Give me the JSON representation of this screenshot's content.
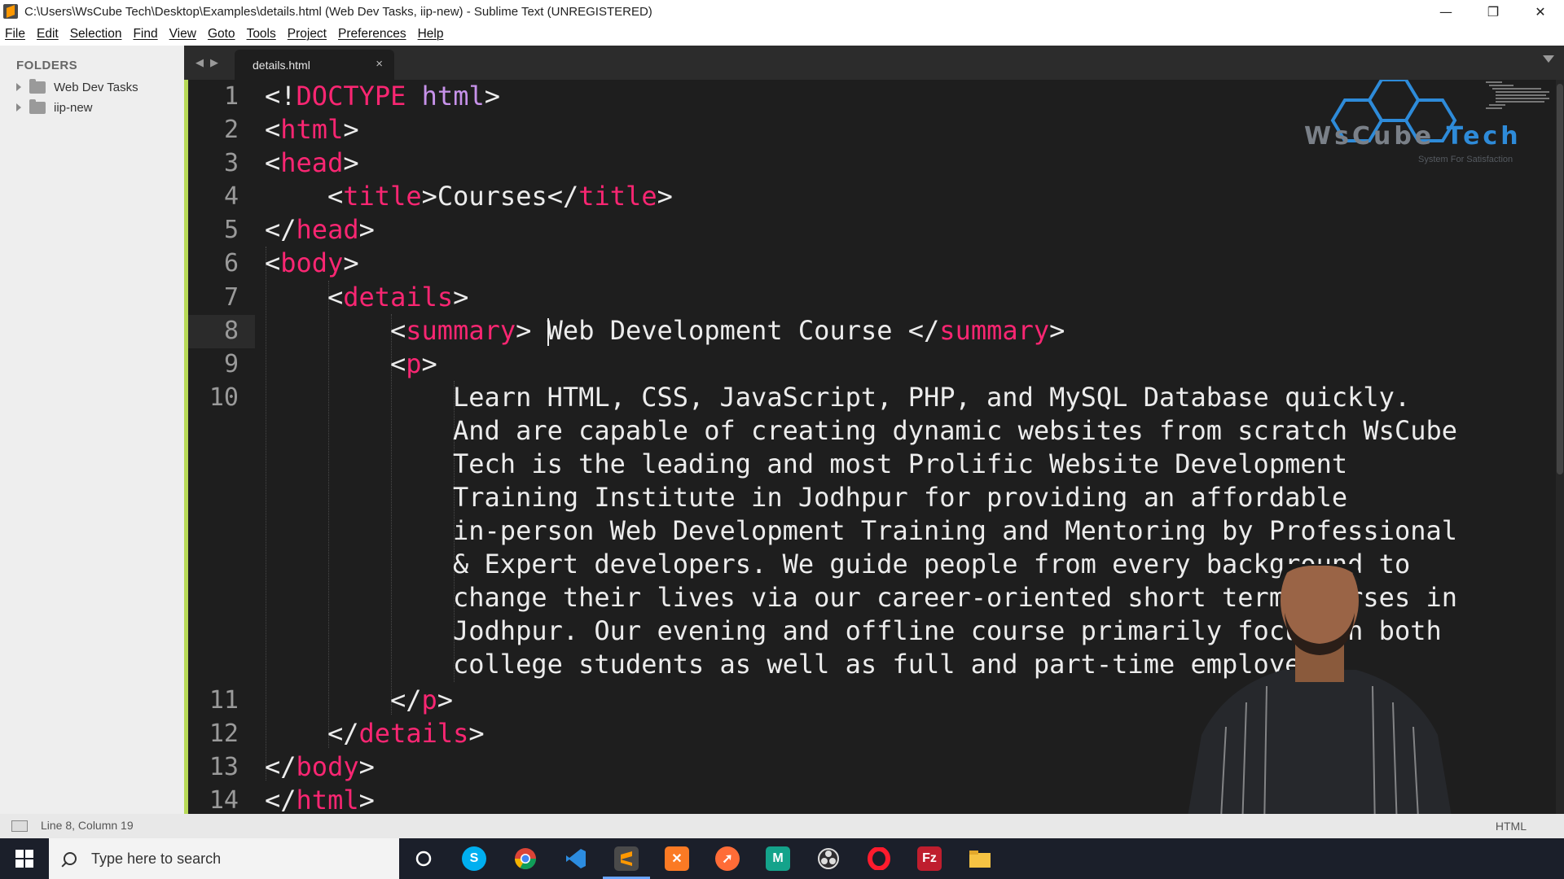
{
  "window": {
    "title": "C:\\Users\\WsCube Tech\\Desktop\\Examples\\details.html (Web Dev Tasks, iip-new) - Sublime Text (UNREGISTERED)",
    "minimize": "—",
    "restore": "❐",
    "close": "✕"
  },
  "menu": [
    "File",
    "Edit",
    "Selection",
    "Find",
    "View",
    "Goto",
    "Tools",
    "Project",
    "Preferences",
    "Help"
  ],
  "sidebar": {
    "heading": "FOLDERS",
    "folders": [
      "Web Dev Tasks",
      "iip-new"
    ]
  },
  "tabs": {
    "active": "details.html",
    "close_glyph": "×",
    "nav_back": "◀",
    "nav_forward": "▶"
  },
  "editor": {
    "line_numbers": [
      "1",
      "2",
      "3",
      "4",
      "5",
      "6",
      "7",
      "8",
      "9",
      "10",
      "",
      "",
      "",
      "",
      "",
      "",
      "",
      "",
      "11",
      "12",
      "13",
      "14"
    ],
    "current_line": "8",
    "code": {
      "l1_a": "<!",
      "l1_b": "DOCTYPE",
      "l1_c": " ",
      "l1_d": "html",
      "l1_e": ">",
      "l2_a": "<",
      "l2_b": "html",
      "l2_c": ">",
      "l3_a": "<",
      "l3_b": "head",
      "l3_c": ">",
      "l4_a": "<",
      "l4_b": "title",
      "l4_c": ">Courses</",
      "l4_d": "title",
      "l4_e": ">",
      "l5_a": "</",
      "l5_b": "head",
      "l5_c": ">",
      "l6_a": "<",
      "l6_b": "body",
      "l6_c": ">",
      "l7_a": "<",
      "l7_b": "details",
      "l7_c": ">",
      "l8_a": "<",
      "l8_b": "summary",
      "l8_c": "> ",
      "l8_d": "Web Development Course </",
      "l8_e": "summary",
      "l8_f": ">",
      "l9_a": "<",
      "l9_b": "p",
      "l9_c": ">",
      "l10_text": [
        "Learn HTML, CSS, JavaScript, PHP, and MySQL Database quickly.",
        "And are capable of creating dynamic websites from scratch WsCube",
        "Tech is the leading and most Prolific Website Development",
        "Training Institute in Jodhpur for providing an affordable",
        "in-person Web Development Training and Mentoring by Professional",
        "& Expert developers. We guide people from every background to",
        "change their lives via our career-oriented short term courses in",
        "Jodhpur. Our evening and offline course primarily focus on both",
        "college students as well as full and part-time employees."
      ],
      "l11_a": "</",
      "l11_b": "p",
      "l11_c": ">",
      "l12_a": "</",
      "l12_b": "details",
      "l12_c": ">",
      "l13_a": "</",
      "l13_b": "body",
      "l13_c": ">",
      "l14_a": "</",
      "l14_b": "html",
      "l14_c": ">"
    }
  },
  "logo": {
    "word1": "WsCube ",
    "word2": "Tech",
    "tagline": "System For Satisfaction"
  },
  "status": {
    "position": "Line 8, Column 19",
    "syntax": "HTML"
  },
  "taskbar": {
    "search_placeholder": "Type here to search",
    "icons": [
      "cortana-icon",
      "skype-icon",
      "chrome-icon",
      "vscode-icon",
      "sublime-icon",
      "xampp-icon",
      "postman-icon",
      "notepad-plus-icon",
      "obs-icon",
      "opera-icon",
      "filezilla-icon",
      "file-explorer-icon"
    ]
  },
  "colors": {
    "tag": "#f92672",
    "text": "#ececec",
    "editor_bg": "#1e1e1e",
    "accent_strip": "#b7d957",
    "logo_blue": "#2e8bd9"
  }
}
